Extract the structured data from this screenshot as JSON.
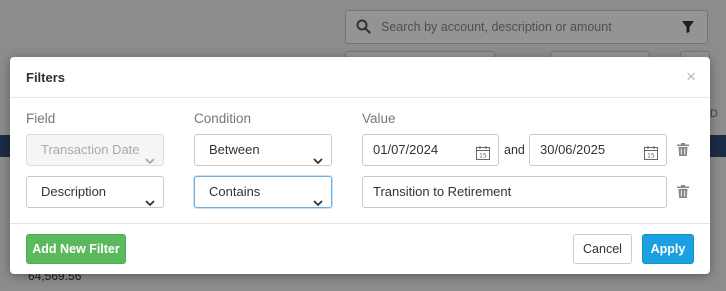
{
  "background": {
    "search_placeholder": "Search by account, description or amount",
    "row_amount": "64,569.56",
    "right_edge_text": "D"
  },
  "modal": {
    "title": "Filters",
    "close_glyph": "×",
    "columns": {
      "field": "Field",
      "condition": "Condition",
      "value": "Value"
    },
    "rows": [
      {
        "field": "Transaction Date",
        "field_disabled": true,
        "condition": "Between",
        "value_from": "01/07/2024",
        "joiner": "and",
        "value_to": "30/06/2025"
      },
      {
        "field": "Description",
        "condition": "Contains",
        "value": "Transition to Retirement"
      }
    ],
    "add_filter_label": "Add New Filter",
    "cancel_label": "Cancel",
    "apply_label": "Apply"
  },
  "colors": {
    "add_button": "#5cb85c",
    "apply_button": "#1ba1e2",
    "focus_border": "#66afe9"
  },
  "icons": {
    "search": "search-icon",
    "filter": "filter-icon",
    "close": "close-icon",
    "calendar": "calendar-icon",
    "trash": "trash-icon",
    "dropdown": "chevron-down-icon"
  }
}
